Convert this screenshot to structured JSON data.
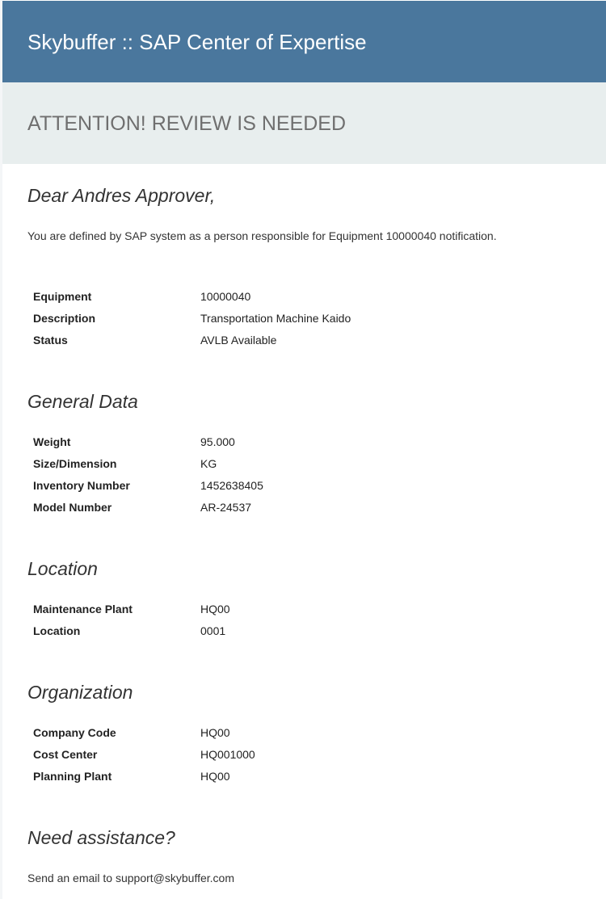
{
  "header": {
    "title": "Skybuffer :: SAP Center of Expertise"
  },
  "banner": {
    "title": "ATTENTION! REVIEW IS NEEDED"
  },
  "greeting": "Dear Andres Approver,",
  "intro": "You are defined by SAP system as a person responsible for Equipment 10000040 notification.",
  "equipment": [
    {
      "label": "Equipment",
      "value": "10000040"
    },
    {
      "label": "Description",
      "value": "Transportation Machine Kaido"
    },
    {
      "label": "Status",
      "value": "AVLB Available"
    }
  ],
  "general_data": {
    "heading": "General Data",
    "rows": [
      {
        "label": "Weight",
        "value": "95.000"
      },
      {
        "label": "Size/Dimension",
        "value": "KG"
      },
      {
        "label": "Inventory Number",
        "value": "1452638405"
      },
      {
        "label": "Model Number",
        "value": "AR-24537"
      }
    ]
  },
  "location": {
    "heading": "Location",
    "rows": [
      {
        "label": "Maintenance Plant",
        "value": "HQ00"
      },
      {
        "label": "Location",
        "value": "0001"
      }
    ]
  },
  "organization": {
    "heading": "Organization",
    "rows": [
      {
        "label": "Company Code",
        "value": "HQ00"
      },
      {
        "label": "Cost Center",
        "value": "HQ001000"
      },
      {
        "label": "Planning Plant",
        "value": "HQ00"
      }
    ]
  },
  "assistance": {
    "heading": "Need assistance?",
    "text": "Send an email to support@skybuffer.com"
  },
  "colors": {
    "header_bg": "#4a779d",
    "banner_bg": "#e8eeee",
    "banner_text": "#6f6f6f"
  }
}
